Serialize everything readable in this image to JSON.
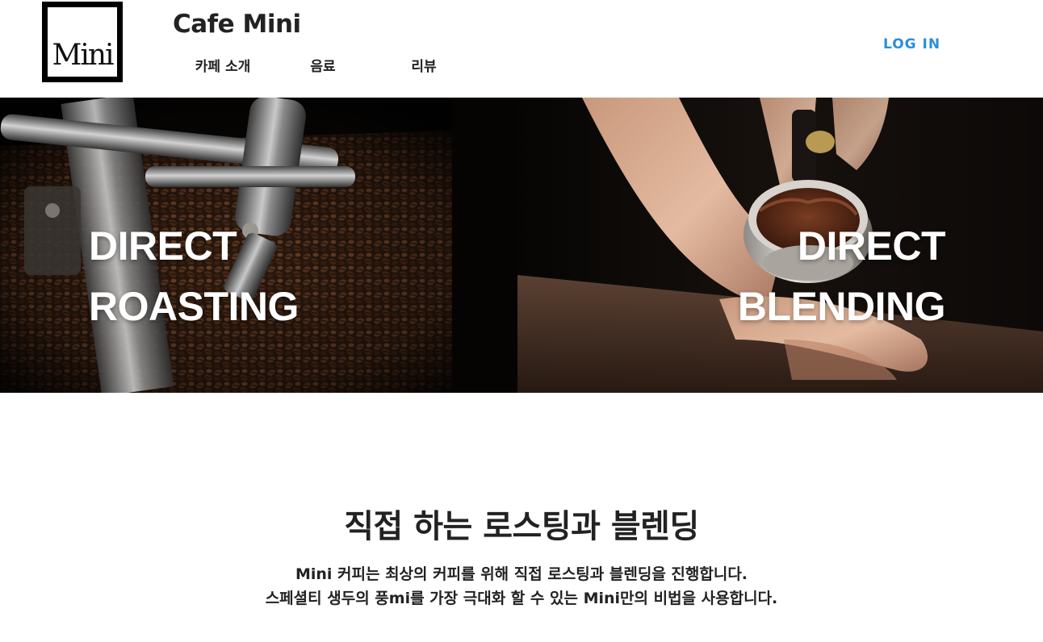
{
  "header": {
    "logo_text": "Mini",
    "brand": "Cafe Mini",
    "nav": [
      "카페 소개",
      "음료",
      "리뷰"
    ],
    "login": "LOG IN",
    "login_color": "#2b8fd8"
  },
  "hero": {
    "left": {
      "lines": [
        "DIRECT",
        "ROASTING"
      ],
      "image": "coffee-roaster-beans"
    },
    "right": {
      "lines": [
        "DIRECT",
        "BLENDING"
      ],
      "image": "hand-holding-portafilter-ground-coffee"
    }
  },
  "intro": {
    "title": "직접 하는 로스팅과 블렌딩",
    "line1": "Mini 커피는 최상의 커피를 위해 직접 로스팅과 블렌딩을 진행합니다.",
    "line2": "스페셜티 생두의 풍mi를 가장 극대화 할 수 있는 Mini만의 비법을 사용합니다."
  }
}
